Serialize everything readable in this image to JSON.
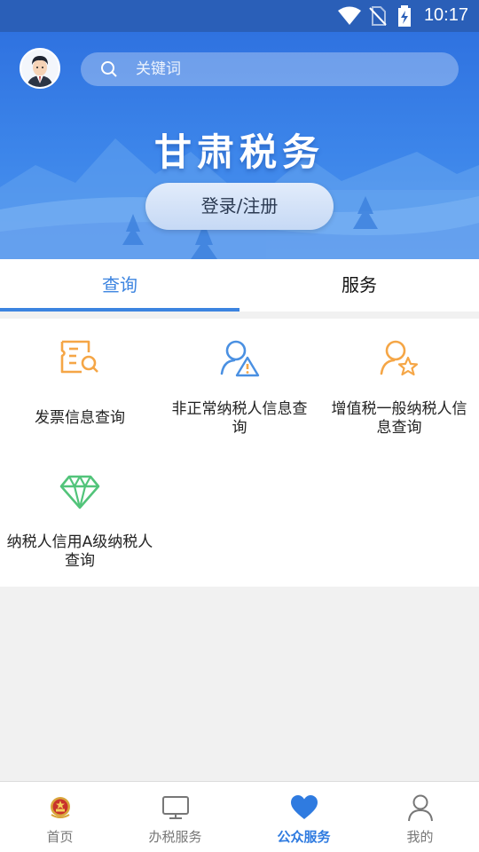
{
  "status_bar": {
    "time": "10:17"
  },
  "header": {
    "search_placeholder": "关键词",
    "title": "甘肃税务",
    "login_label": "登录/注册"
  },
  "tabs": [
    {
      "label": "查询",
      "active": true
    },
    {
      "label": "服务",
      "active": false
    }
  ],
  "services": [
    {
      "label": "发票信息查询",
      "icon": "invoice-search-icon"
    },
    {
      "label": "非正常纳税人信息查询",
      "icon": "user-warning-icon"
    },
    {
      "label": "增值税一般纳税人信息查询",
      "icon": "user-star-icon"
    },
    {
      "label": "纳税人信用A级纳税人查询",
      "icon": "diamond-icon"
    }
  ],
  "bottom_nav": [
    {
      "label": "首页",
      "icon": "emblem-icon",
      "active": false
    },
    {
      "label": "办税服务",
      "icon": "monitor-icon",
      "active": false
    },
    {
      "label": "公众服务",
      "icon": "heart-icon",
      "active": true
    },
    {
      "label": "我的",
      "icon": "person-icon",
      "active": false
    }
  ],
  "colors": {
    "accent": "#3c84e0",
    "hero": "#3d86ea",
    "orange": "#f5a646",
    "blue_icon": "#4a90e2",
    "green": "#52c47a"
  }
}
